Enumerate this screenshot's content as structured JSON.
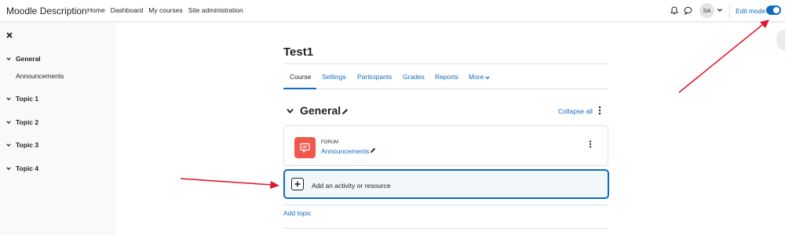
{
  "navbar": {
    "brand": "Moodle Description",
    "links": [
      "Home",
      "Dashboard",
      "My courses",
      "Site administration"
    ],
    "avatar_initials": "SA",
    "edit_mode_label": "Edit mode",
    "edit_mode_on": true
  },
  "drawer": {
    "items": [
      {
        "label": "General",
        "expanded": true
      },
      {
        "label": "Announcements",
        "indent": true
      },
      {
        "label": "Topic 1"
      },
      {
        "label": "Topic 2"
      },
      {
        "label": "Topic 3"
      },
      {
        "label": "Topic 4"
      }
    ]
  },
  "course": {
    "title": "Test1",
    "tabs": [
      "Course",
      "Settings",
      "Participants",
      "Grades",
      "Reports",
      "More"
    ],
    "active_tab": "Course"
  },
  "section": {
    "title": "General",
    "collapse_all": "Collapse all"
  },
  "activity": {
    "type": "FORUM",
    "name": "Announcements"
  },
  "add_activity_label": "Add an activity or resource",
  "add_topic_label": "Add topic",
  "colors": {
    "accent": "#0f6cbf",
    "forum_icon": "#f0584e",
    "annotation_arrow": "#e0182d"
  }
}
